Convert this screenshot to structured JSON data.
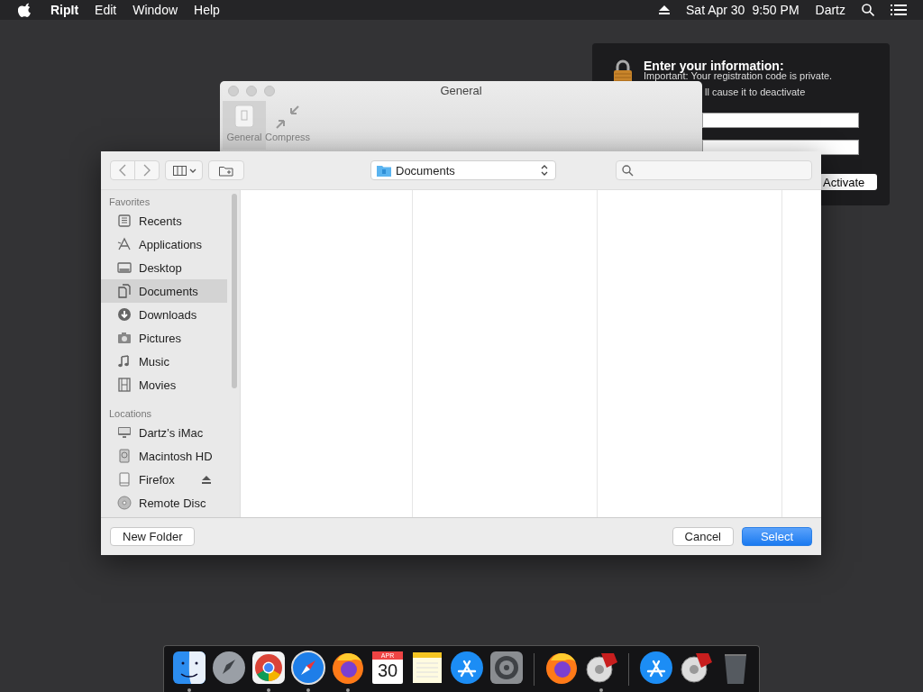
{
  "menu_bar": {
    "app_name": "RipIt",
    "menus": [
      "Edit",
      "Window",
      "Help"
    ],
    "date": "Sat Apr 30",
    "time": "9:50 PM",
    "user": "Dartz"
  },
  "registration_panel": {
    "title": "Enter your information:",
    "lines": [
      "Important: Your registration code is private.",
      "ll cause it to deactivate"
    ],
    "fields": [
      {
        "kind": "text"
      },
      {
        "kind": "text"
      }
    ],
    "button": "Activate"
  },
  "general_window": {
    "title": "General",
    "toolbar": [
      {
        "label": "General",
        "kind": "general",
        "selected": true
      },
      {
        "label": "Compress",
        "kind": "compress",
        "selected": false
      }
    ]
  },
  "file_dialog": {
    "location": "Documents",
    "sidebar": [
      {
        "heading": "Favorites",
        "items": [
          {
            "label": "Recents",
            "kind": "recents",
            "selected": false
          },
          {
            "label": "Applications",
            "kind": "applications",
            "selected": false
          },
          {
            "label": "Desktop",
            "kind": "desktop",
            "selected": false
          },
          {
            "label": "Documents",
            "kind": "documents",
            "selected": true
          },
          {
            "label": "Downloads",
            "kind": "downloads",
            "selected": false
          },
          {
            "label": "Pictures",
            "kind": "pictures",
            "selected": false
          },
          {
            "label": "Music",
            "kind": "music",
            "selected": false
          },
          {
            "label": "Movies",
            "kind": "movies",
            "selected": false
          }
        ]
      },
      {
        "heading": "Locations",
        "items": [
          {
            "label": "Dartz’s iMac",
            "kind": "imac",
            "selected": false
          },
          {
            "label": "Macintosh HD",
            "kind": "disk",
            "selected": false
          },
          {
            "label": "Firefox",
            "kind": "volume",
            "selected": false,
            "ejectable": true
          },
          {
            "label": "Remote Disc",
            "kind": "disc",
            "selected": false
          }
        ]
      }
    ],
    "buttons": [
      {
        "label": "New Folder",
        "kind": "secondary"
      },
      {
        "label": "Cancel",
        "kind": "secondary"
      },
      {
        "label": "Select",
        "kind": "primary"
      }
    ]
  },
  "dock": {
    "items": [
      {
        "kind": "finder",
        "running": true
      },
      {
        "kind": "launchpad",
        "running": false
      },
      {
        "kind": "chrome",
        "running": true
      },
      {
        "kind": "safari",
        "running": true
      },
      {
        "kind": "firefox",
        "running": true
      },
      {
        "kind": "calendar",
        "running": false,
        "month": "APR",
        "day": "30"
      },
      {
        "kind": "notes",
        "running": false
      },
      {
        "kind": "appstore",
        "running": false
      },
      {
        "kind": "settings",
        "running": false
      },
      {
        "kind": "separator"
      },
      {
        "kind": "firefox",
        "running": false
      },
      {
        "kind": "saw",
        "running": true
      },
      {
        "kind": "separator"
      },
      {
        "kind": "appstore",
        "running": false
      },
      {
        "kind": "saw",
        "running": false
      },
      {
        "kind": "trash",
        "running": false
      }
    ]
  }
}
